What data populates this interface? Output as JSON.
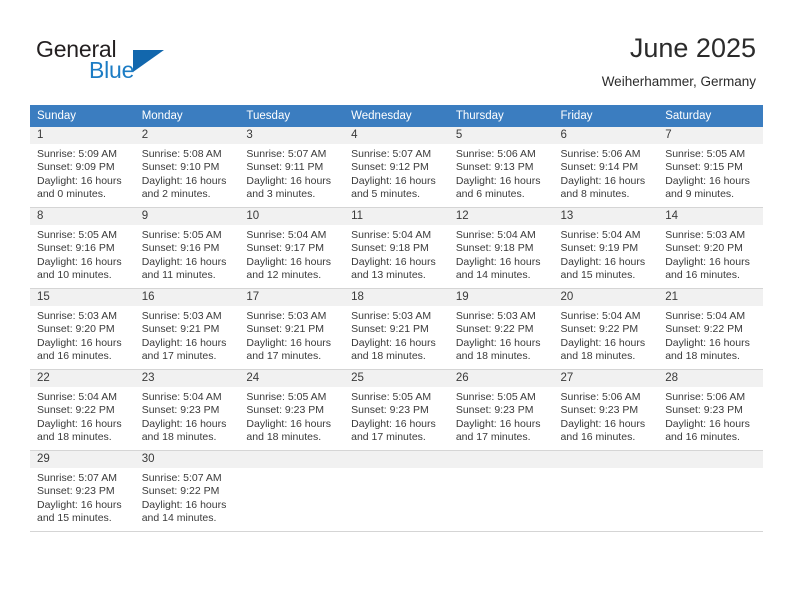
{
  "brand": {
    "name_part1": "General",
    "name_part2": "Blue",
    "logo_icon": "triangle-logo-icon"
  },
  "header": {
    "title": "June 2025",
    "location": "Weiherhammer, Germany"
  },
  "colors": {
    "header_row": "#3b7dc0",
    "brand_blue": "#1c7cc4",
    "cell_head": "#f1f1f1",
    "grid_line": "#d5d5d5"
  },
  "calendar": {
    "weekdays": [
      "Sunday",
      "Monday",
      "Tuesday",
      "Wednesday",
      "Thursday",
      "Friday",
      "Saturday"
    ],
    "weeks": [
      [
        {
          "day": "1",
          "sunrise": "Sunrise: 5:09 AM",
          "sunset": "Sunset: 9:09 PM",
          "daylight_line1": "Daylight: 16 hours",
          "daylight_line2": "and 0 minutes."
        },
        {
          "day": "2",
          "sunrise": "Sunrise: 5:08 AM",
          "sunset": "Sunset: 9:10 PM",
          "daylight_line1": "Daylight: 16 hours",
          "daylight_line2": "and 2 minutes."
        },
        {
          "day": "3",
          "sunrise": "Sunrise: 5:07 AM",
          "sunset": "Sunset: 9:11 PM",
          "daylight_line1": "Daylight: 16 hours",
          "daylight_line2": "and 3 minutes."
        },
        {
          "day": "4",
          "sunrise": "Sunrise: 5:07 AM",
          "sunset": "Sunset: 9:12 PM",
          "daylight_line1": "Daylight: 16 hours",
          "daylight_line2": "and 5 minutes."
        },
        {
          "day": "5",
          "sunrise": "Sunrise: 5:06 AM",
          "sunset": "Sunset: 9:13 PM",
          "daylight_line1": "Daylight: 16 hours",
          "daylight_line2": "and 6 minutes."
        },
        {
          "day": "6",
          "sunrise": "Sunrise: 5:06 AM",
          "sunset": "Sunset: 9:14 PM",
          "daylight_line1": "Daylight: 16 hours",
          "daylight_line2": "and 8 minutes."
        },
        {
          "day": "7",
          "sunrise": "Sunrise: 5:05 AM",
          "sunset": "Sunset: 9:15 PM",
          "daylight_line1": "Daylight: 16 hours",
          "daylight_line2": "and 9 minutes."
        }
      ],
      [
        {
          "day": "8",
          "sunrise": "Sunrise: 5:05 AM",
          "sunset": "Sunset: 9:16 PM",
          "daylight_line1": "Daylight: 16 hours",
          "daylight_line2": "and 10 minutes."
        },
        {
          "day": "9",
          "sunrise": "Sunrise: 5:05 AM",
          "sunset": "Sunset: 9:16 PM",
          "daylight_line1": "Daylight: 16 hours",
          "daylight_line2": "and 11 minutes."
        },
        {
          "day": "10",
          "sunrise": "Sunrise: 5:04 AM",
          "sunset": "Sunset: 9:17 PM",
          "daylight_line1": "Daylight: 16 hours",
          "daylight_line2": "and 12 minutes."
        },
        {
          "day": "11",
          "sunrise": "Sunrise: 5:04 AM",
          "sunset": "Sunset: 9:18 PM",
          "daylight_line1": "Daylight: 16 hours",
          "daylight_line2": "and 13 minutes."
        },
        {
          "day": "12",
          "sunrise": "Sunrise: 5:04 AM",
          "sunset": "Sunset: 9:18 PM",
          "daylight_line1": "Daylight: 16 hours",
          "daylight_line2": "and 14 minutes."
        },
        {
          "day": "13",
          "sunrise": "Sunrise: 5:04 AM",
          "sunset": "Sunset: 9:19 PM",
          "daylight_line1": "Daylight: 16 hours",
          "daylight_line2": "and 15 minutes."
        },
        {
          "day": "14",
          "sunrise": "Sunrise: 5:03 AM",
          "sunset": "Sunset: 9:20 PM",
          "daylight_line1": "Daylight: 16 hours",
          "daylight_line2": "and 16 minutes."
        }
      ],
      [
        {
          "day": "15",
          "sunrise": "Sunrise: 5:03 AM",
          "sunset": "Sunset: 9:20 PM",
          "daylight_line1": "Daylight: 16 hours",
          "daylight_line2": "and 16 minutes."
        },
        {
          "day": "16",
          "sunrise": "Sunrise: 5:03 AM",
          "sunset": "Sunset: 9:21 PM",
          "daylight_line1": "Daylight: 16 hours",
          "daylight_line2": "and 17 minutes."
        },
        {
          "day": "17",
          "sunrise": "Sunrise: 5:03 AM",
          "sunset": "Sunset: 9:21 PM",
          "daylight_line1": "Daylight: 16 hours",
          "daylight_line2": "and 17 minutes."
        },
        {
          "day": "18",
          "sunrise": "Sunrise: 5:03 AM",
          "sunset": "Sunset: 9:21 PM",
          "daylight_line1": "Daylight: 16 hours",
          "daylight_line2": "and 18 minutes."
        },
        {
          "day": "19",
          "sunrise": "Sunrise: 5:03 AM",
          "sunset": "Sunset: 9:22 PM",
          "daylight_line1": "Daylight: 16 hours",
          "daylight_line2": "and 18 minutes."
        },
        {
          "day": "20",
          "sunrise": "Sunrise: 5:04 AM",
          "sunset": "Sunset: 9:22 PM",
          "daylight_line1": "Daylight: 16 hours",
          "daylight_line2": "and 18 minutes."
        },
        {
          "day": "21",
          "sunrise": "Sunrise: 5:04 AM",
          "sunset": "Sunset: 9:22 PM",
          "daylight_line1": "Daylight: 16 hours",
          "daylight_line2": "and 18 minutes."
        }
      ],
      [
        {
          "day": "22",
          "sunrise": "Sunrise: 5:04 AM",
          "sunset": "Sunset: 9:22 PM",
          "daylight_line1": "Daylight: 16 hours",
          "daylight_line2": "and 18 minutes."
        },
        {
          "day": "23",
          "sunrise": "Sunrise: 5:04 AM",
          "sunset": "Sunset: 9:23 PM",
          "daylight_line1": "Daylight: 16 hours",
          "daylight_line2": "and 18 minutes."
        },
        {
          "day": "24",
          "sunrise": "Sunrise: 5:05 AM",
          "sunset": "Sunset: 9:23 PM",
          "daylight_line1": "Daylight: 16 hours",
          "daylight_line2": "and 18 minutes."
        },
        {
          "day": "25",
          "sunrise": "Sunrise: 5:05 AM",
          "sunset": "Sunset: 9:23 PM",
          "daylight_line1": "Daylight: 16 hours",
          "daylight_line2": "and 17 minutes."
        },
        {
          "day": "26",
          "sunrise": "Sunrise: 5:05 AM",
          "sunset": "Sunset: 9:23 PM",
          "daylight_line1": "Daylight: 16 hours",
          "daylight_line2": "and 17 minutes."
        },
        {
          "day": "27",
          "sunrise": "Sunrise: 5:06 AM",
          "sunset": "Sunset: 9:23 PM",
          "daylight_line1": "Daylight: 16 hours",
          "daylight_line2": "and 16 minutes."
        },
        {
          "day": "28",
          "sunrise": "Sunrise: 5:06 AM",
          "sunset": "Sunset: 9:23 PM",
          "daylight_line1": "Daylight: 16 hours",
          "daylight_line2": "and 16 minutes."
        }
      ],
      [
        {
          "day": "29",
          "sunrise": "Sunrise: 5:07 AM",
          "sunset": "Sunset: 9:23 PM",
          "daylight_line1": "Daylight: 16 hours",
          "daylight_line2": "and 15 minutes."
        },
        {
          "day": "30",
          "sunrise": "Sunrise: 5:07 AM",
          "sunset": "Sunset: 9:22 PM",
          "daylight_line1": "Daylight: 16 hours",
          "daylight_line2": "and 14 minutes."
        },
        {
          "day": "",
          "sunrise": "",
          "sunset": "",
          "daylight_line1": "",
          "daylight_line2": ""
        },
        {
          "day": "",
          "sunrise": "",
          "sunset": "",
          "daylight_line1": "",
          "daylight_line2": ""
        },
        {
          "day": "",
          "sunrise": "",
          "sunset": "",
          "daylight_line1": "",
          "daylight_line2": ""
        },
        {
          "day": "",
          "sunrise": "",
          "sunset": "",
          "daylight_line1": "",
          "daylight_line2": ""
        },
        {
          "day": "",
          "sunrise": "",
          "sunset": "",
          "daylight_line1": "",
          "daylight_line2": ""
        }
      ]
    ]
  }
}
